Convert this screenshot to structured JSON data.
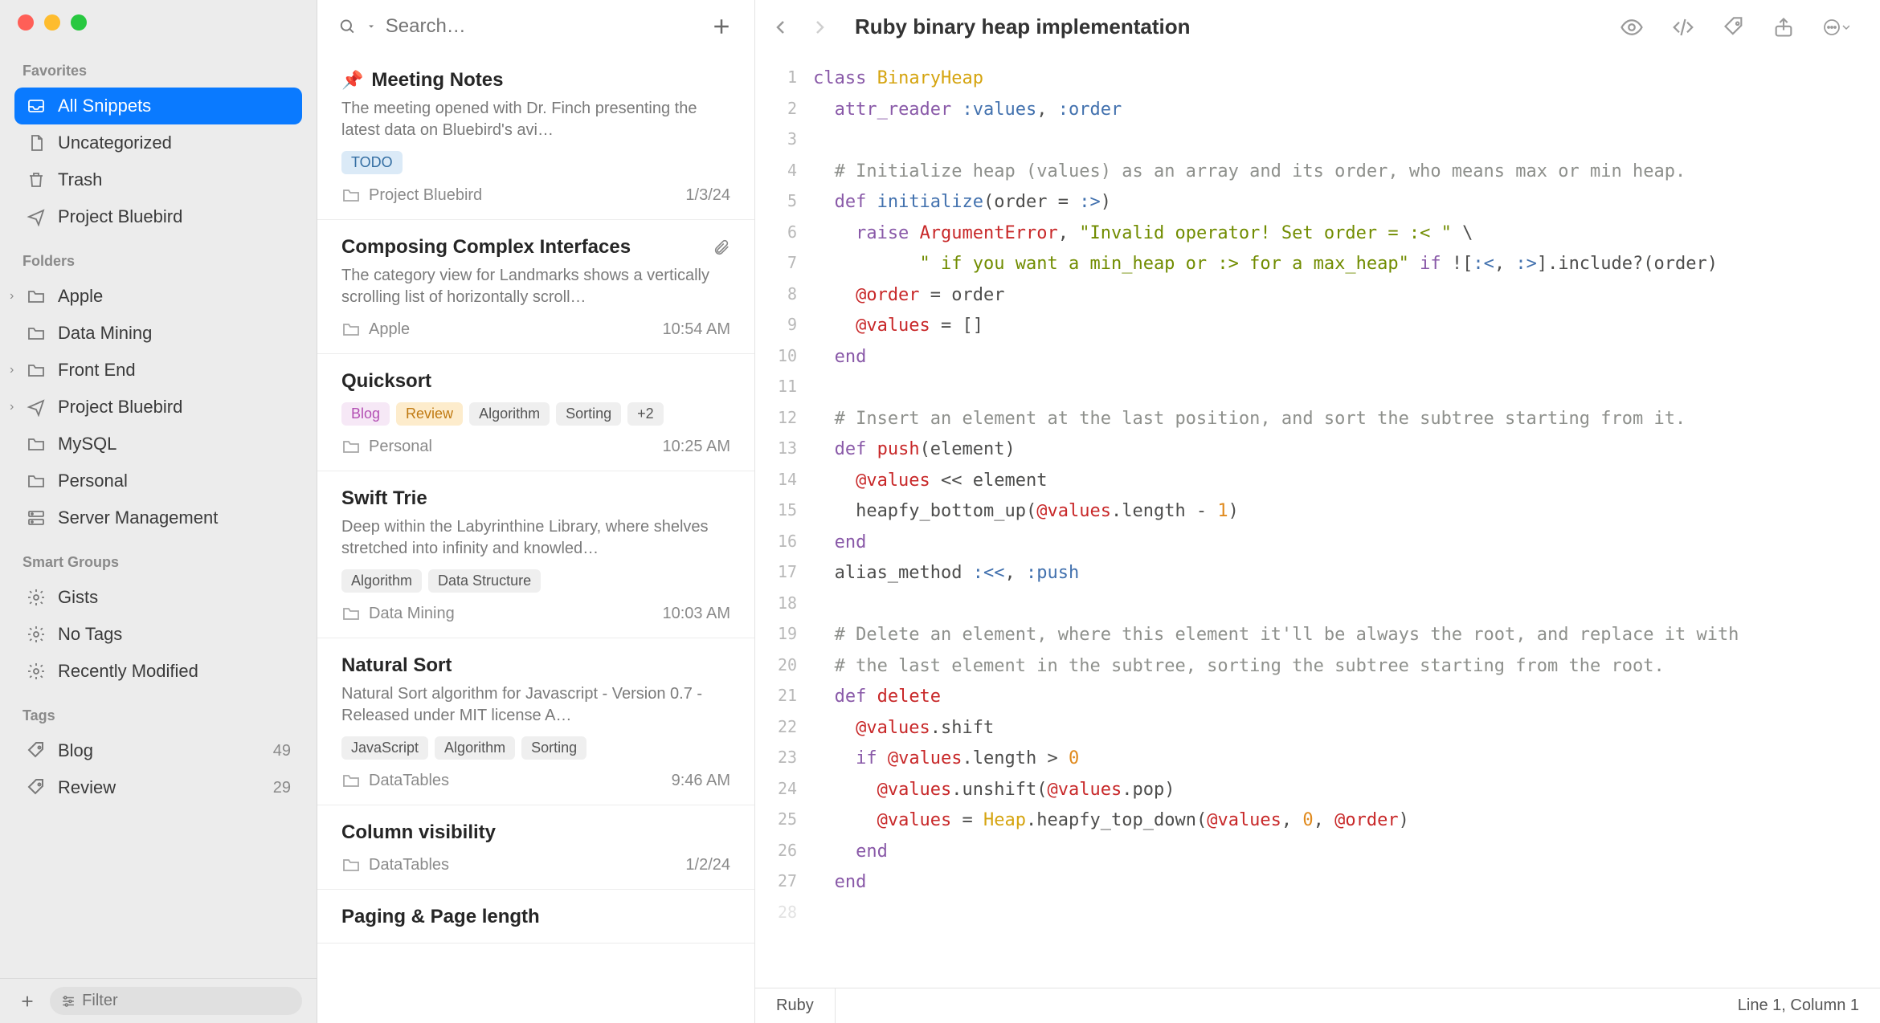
{
  "sidebar": {
    "sections": {
      "favorites": "Favorites",
      "folders": "Folders",
      "smart": "Smart Groups",
      "tags": "Tags"
    },
    "favorites": [
      {
        "label": "All Snippets",
        "icon": "inbox"
      },
      {
        "label": "Uncategorized",
        "icon": "doc"
      },
      {
        "label": "Trash",
        "icon": "trash"
      },
      {
        "label": "Project Bluebird",
        "icon": "plane"
      }
    ],
    "folders": [
      {
        "label": "Apple",
        "expandable": true
      },
      {
        "label": "Data Mining",
        "expandable": false
      },
      {
        "label": "Front End",
        "expandable": true
      },
      {
        "label": "Project Bluebird",
        "expandable": true,
        "icon": "plane"
      },
      {
        "label": "MySQL",
        "expandable": false
      },
      {
        "label": "Personal",
        "expandable": false
      },
      {
        "label": "Server Management",
        "expandable": false,
        "icon": "server"
      }
    ],
    "smart": [
      {
        "label": "Gists"
      },
      {
        "label": "No Tags"
      },
      {
        "label": "Recently Modified"
      }
    ],
    "tags": [
      {
        "label": "Blog",
        "count": 49,
        "color": "#b34fb3"
      },
      {
        "label": "Review",
        "count": 29,
        "color": "#e6a23c"
      }
    ],
    "filter_placeholder": "Filter"
  },
  "list": {
    "search_placeholder": "Search…",
    "snippets": [
      {
        "title": "Meeting Notes",
        "pinned": true,
        "preview": "The meeting opened with Dr. Finch presenting the latest data on Bluebird's avi…",
        "chips": [
          {
            "label": "TODO",
            "class": "todo"
          }
        ],
        "folder": "Project Bluebird",
        "timestamp": "1/3/24"
      },
      {
        "title": "Composing Complex Interfaces",
        "attachment": true,
        "preview": "The category view for Landmarks shows a vertically scrolling list of horizontally scroll…",
        "chips": [],
        "folder": "Apple",
        "timestamp": "10:54 AM"
      },
      {
        "title": "Quicksort",
        "preview": "",
        "chips": [
          {
            "label": "Blog",
            "class": "blog"
          },
          {
            "label": "Review",
            "class": "review"
          },
          {
            "label": "Algorithm",
            "class": ""
          },
          {
            "label": "Sorting",
            "class": ""
          },
          {
            "label": "+2",
            "class": ""
          }
        ],
        "folder": "Personal",
        "timestamp": "10:25 AM"
      },
      {
        "title": "Swift Trie",
        "preview": "Deep within the Labyrinthine Library, where shelves stretched into infinity and knowled…",
        "chips": [
          {
            "label": "Algorithm",
            "class": ""
          },
          {
            "label": "Data Structure",
            "class": ""
          }
        ],
        "folder": "Data Mining",
        "timestamp": "10:03 AM"
      },
      {
        "title": "Natural Sort",
        "preview": "Natural Sort algorithm for Javascript - Version 0.7 - Released under MIT license A…",
        "chips": [
          {
            "label": "JavaScript",
            "class": ""
          },
          {
            "label": "Algorithm",
            "class": ""
          },
          {
            "label": "Sorting",
            "class": ""
          }
        ],
        "folder": "DataTables",
        "timestamp": "9:46 AM"
      },
      {
        "title": "Column visibility",
        "preview": "",
        "chips": [],
        "folder": "DataTables",
        "timestamp": "1/2/24"
      },
      {
        "title": "Paging & Page length",
        "preview": "",
        "chips": [],
        "folder": "",
        "timestamp": ""
      }
    ]
  },
  "editor": {
    "title": "Ruby binary heap implementation",
    "language": "Ruby",
    "cursor": "Line 1, Column 1",
    "code_lines": [
      [
        [
          "kw",
          "class "
        ],
        [
          "class",
          "BinaryHeap"
        ]
      ],
      [
        [
          "plain",
          "  "
        ],
        [
          "kw",
          "attr_reader"
        ],
        [
          "plain",
          " "
        ],
        [
          "sym",
          ":values"
        ],
        [
          "plain",
          ", "
        ],
        [
          "sym",
          ":order"
        ]
      ],
      [],
      [
        [
          "plain",
          "  "
        ],
        [
          "cmt",
          "# Initialize heap (values) as an array and its order, who means max or min heap."
        ]
      ],
      [
        [
          "plain",
          "  "
        ],
        [
          "kw",
          "def "
        ],
        [
          "fn",
          "initialize"
        ],
        [
          "plain",
          "(order = "
        ],
        [
          "sym",
          ":>"
        ],
        [
          "plain",
          ")"
        ]
      ],
      [
        [
          "plain",
          "    "
        ],
        [
          "kw",
          "raise "
        ],
        [
          "err",
          "ArgumentError"
        ],
        [
          "plain",
          ", "
        ],
        [
          "str",
          "\"Invalid operator! Set order = :< \""
        ],
        [
          "plain",
          " \\"
        ]
      ],
      [
        [
          "plain",
          "          "
        ],
        [
          "str",
          "\" if you want a min_heap or :> for a max_heap\""
        ],
        [
          "plain",
          " "
        ],
        [
          "kw",
          "if"
        ],
        [
          "plain",
          " !["
        ],
        [
          "sym",
          ":<"
        ],
        [
          "plain",
          ", "
        ],
        [
          "sym",
          ":>"
        ],
        [
          "plain",
          "].include?(order)"
        ]
      ],
      [
        [
          "plain",
          "    "
        ],
        [
          "ivar",
          "@order"
        ],
        [
          "plain",
          " = order"
        ]
      ],
      [
        [
          "plain",
          "    "
        ],
        [
          "ivar",
          "@values"
        ],
        [
          "plain",
          " = []"
        ]
      ],
      [
        [
          "plain",
          "  "
        ],
        [
          "kw",
          "end"
        ]
      ],
      [],
      [
        [
          "plain",
          "  "
        ],
        [
          "cmt",
          "# Insert an element at the last position, and sort the subtree starting from it."
        ]
      ],
      [
        [
          "plain",
          "  "
        ],
        [
          "kw",
          "def "
        ],
        [
          "def",
          "push"
        ],
        [
          "plain",
          "(element)"
        ]
      ],
      [
        [
          "plain",
          "    "
        ],
        [
          "ivar",
          "@values"
        ],
        [
          "plain",
          " << element"
        ]
      ],
      [
        [
          "plain",
          "    heapfy_bottom_up("
        ],
        [
          "ivar",
          "@values"
        ],
        [
          "plain",
          ".length - "
        ],
        [
          "num",
          "1"
        ],
        [
          "plain",
          ")"
        ]
      ],
      [
        [
          "plain",
          "  "
        ],
        [
          "kw",
          "end"
        ]
      ],
      [
        [
          "plain",
          "  alias_method "
        ],
        [
          "sym",
          ":<<"
        ],
        [
          "plain",
          ", "
        ],
        [
          "sym",
          ":push"
        ]
      ],
      [],
      [
        [
          "plain",
          "  "
        ],
        [
          "cmt",
          "# Delete an element, where this element it'll be always the root, and replace it with"
        ]
      ],
      [
        [
          "plain",
          "  "
        ],
        [
          "cmt",
          "# the last element in the subtree, sorting the subtree starting from the root."
        ]
      ],
      [
        [
          "plain",
          "  "
        ],
        [
          "kw",
          "def "
        ],
        [
          "def",
          "delete"
        ]
      ],
      [
        [
          "plain",
          "    "
        ],
        [
          "ivar",
          "@values"
        ],
        [
          "plain",
          ".shift"
        ]
      ],
      [
        [
          "plain",
          "    "
        ],
        [
          "kw",
          "if"
        ],
        [
          "plain",
          " "
        ],
        [
          "ivar",
          "@values"
        ],
        [
          "plain",
          ".length > "
        ],
        [
          "num",
          "0"
        ]
      ],
      [
        [
          "plain",
          "      "
        ],
        [
          "ivar",
          "@values"
        ],
        [
          "plain",
          ".unshift("
        ],
        [
          "ivar",
          "@values"
        ],
        [
          "plain",
          ".pop)"
        ]
      ],
      [
        [
          "plain",
          "      "
        ],
        [
          "ivar",
          "@values"
        ],
        [
          "plain",
          " = "
        ],
        [
          "const",
          "Heap"
        ],
        [
          "plain",
          ".heapfy_top_down("
        ],
        [
          "ivar",
          "@values"
        ],
        [
          "plain",
          ", "
        ],
        [
          "num",
          "0"
        ],
        [
          "plain",
          ", "
        ],
        [
          "ivar",
          "@order"
        ],
        [
          "plain",
          ")"
        ]
      ],
      [
        [
          "plain",
          "    "
        ],
        [
          "kw",
          "end"
        ]
      ],
      [
        [
          "plain",
          "  "
        ],
        [
          "kw",
          "end"
        ]
      ]
    ]
  }
}
